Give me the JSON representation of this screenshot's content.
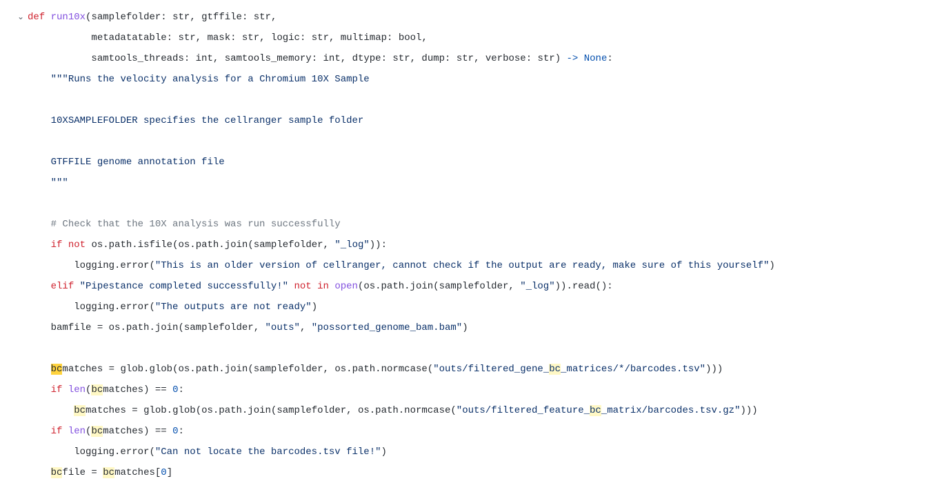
{
  "code": {
    "keywords": {
      "def": "def",
      "if": "if",
      "not": "not",
      "elif": "elif",
      "not_in": "not in",
      "in": "in",
      "none": "None"
    },
    "funcname": "run10x",
    "params": {
      "samplefolder": "samplefolder",
      "gtffile": "gtffile",
      "metadatatable": "metadatatable",
      "mask": "mask",
      "logic": "logic",
      "multimap": "multimap",
      "samtools_threads": "samtools_threads",
      "samtools_memory": "samtools_memory",
      "dtype": "dtype",
      "dump": "dump",
      "verbose": "verbose"
    },
    "types": {
      "str": "str",
      "bool": "bool",
      "int": "int"
    },
    "arrow": "->",
    "docstring": {
      "open": "\"\"\"",
      "line1": "Runs the velocity analysis for a Chromium 10X Sample",
      "line2": "10XSAMPLEFOLDER specifies the cellranger sample folder",
      "line3": "GTFFILE genome annotation file",
      "close": "\"\"\""
    },
    "comment1": "# Check that the 10X analysis was run successfully",
    "strings": {
      "log": "\"_log\"",
      "older_version": "\"This is an older version of cellranger, cannot check if the output are ready, make sure of this yourself\"",
      "pipestance": "\"Pipestance completed successfully!\"",
      "outputs_not_ready": "\"The outputs are not ready\"",
      "outs": "\"outs\"",
      "possorted": "\"possorted_genome_bam.bam\"",
      "filtered_gene_pre": "\"outs/filtered_gene_",
      "filtered_gene_post": "_matrices/*/barcodes.tsv\"",
      "filtered_feature_pre": "\"outs/filtered_feature_",
      "filtered_feature_post": "_matrix/barcodes.tsv.gz\"",
      "cannot_locate": "\"Can not locate the barcodes.tsv file!\""
    },
    "vars": {
      "bamfile": "bamfile",
      "bcmatches_bc": "bc",
      "bcmatches_rest": "matches",
      "bcfile_bc": "bc",
      "bcfile_rest": "file",
      "bc_in_string": "bc"
    },
    "calls": {
      "os_path_isfile": "os.path.isfile",
      "os_path_join": "os.path.join",
      "logging_error": "logging.error",
      "open": "open",
      "read": ".read()",
      "glob_glob": "glob.glob",
      "os_path_normcase": "os.path.normcase",
      "len": "len"
    },
    "nums": {
      "zero": "0"
    },
    "ops": {
      "assign": " = ",
      "eq": " == "
    }
  }
}
